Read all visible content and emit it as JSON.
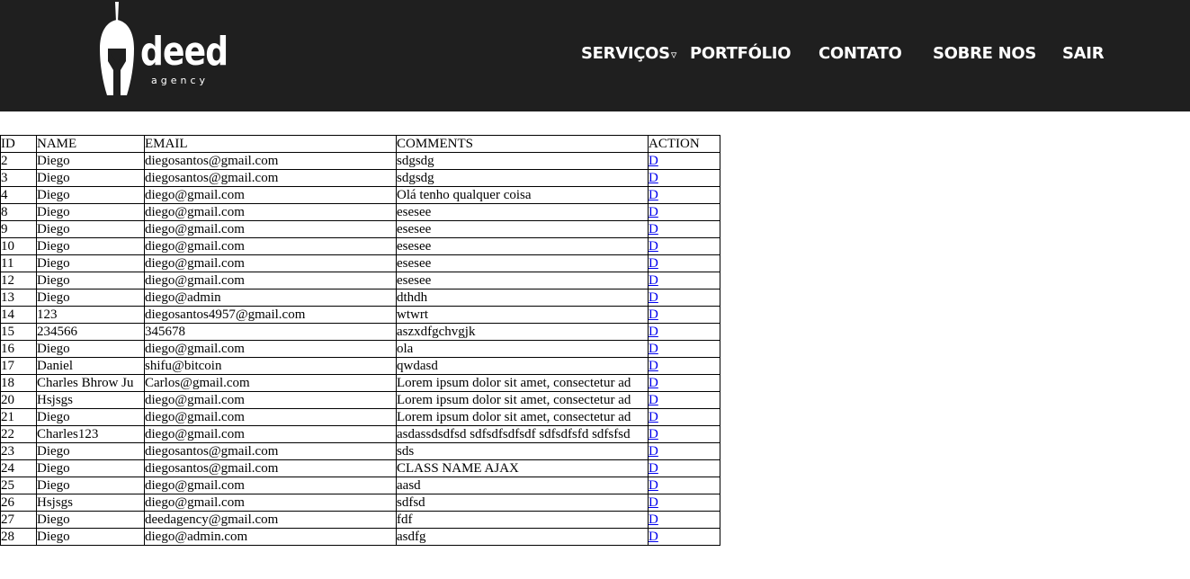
{
  "brand": {
    "name": "deed",
    "tagline": "agency"
  },
  "nav": {
    "items": [
      {
        "label": "SERVIÇOS",
        "caret": "▿"
      },
      {
        "label": "PORTFÓLIO"
      },
      {
        "label": "CONTATO"
      },
      {
        "label": "SOBRE NOS"
      },
      {
        "label": "SAIR"
      }
    ]
  },
  "table": {
    "headers": [
      "ID",
      "NAME",
      "EMAIL",
      "COMMENTS",
      "ACTION"
    ],
    "rows": [
      {
        "id": "2",
        "name": "Diego",
        "email": "diegosantos@gmail.com",
        "comments": "sdgsdg",
        "action": "D"
      },
      {
        "id": "3",
        "name": "Diego",
        "email": "diegosantos@gmail.com",
        "comments": "sdgsdg",
        "action": "D"
      },
      {
        "id": "4",
        "name": "Diego",
        "email": "diego@gmail.com",
        "comments": "Olá tenho qualquer coisa",
        "action": "D"
      },
      {
        "id": "8",
        "name": "Diego",
        "email": "diego@gmail.com",
        "comments": "esesee",
        "action": "D"
      },
      {
        "id": "9",
        "name": "Diego",
        "email": "diego@gmail.com",
        "comments": "esesee",
        "action": "D"
      },
      {
        "id": "10",
        "name": "Diego",
        "email": "diego@gmail.com",
        "comments": "esesee",
        "action": "D"
      },
      {
        "id": "11",
        "name": "Diego",
        "email": "diego@gmail.com",
        "comments": "esesee",
        "action": "D"
      },
      {
        "id": "12",
        "name": "Diego",
        "email": "diego@gmail.com",
        "comments": "esesee",
        "action": "D"
      },
      {
        "id": "13",
        "name": "Diego",
        "email": "diego@admin",
        "comments": "dthdh",
        "action": "D"
      },
      {
        "id": "14",
        "name": "123",
        "email": "diegosantos4957@gmail.com",
        "comments": "wtwrt",
        "action": "D"
      },
      {
        "id": "15",
        "name": "234566",
        "email": "345678",
        "comments": "aszxdfgchvgjk",
        "action": "D"
      },
      {
        "id": "16",
        "name": "Diego",
        "email": "diego@gmail.com",
        "comments": "ola",
        "action": "D"
      },
      {
        "id": "17",
        "name": "Daniel",
        "email": "shifu@bitcoin",
        "comments": "qwdasd",
        "action": "D"
      },
      {
        "id": "18",
        "name": "Charles Bhrow Ju",
        "email": "Carlos@gmail.com",
        "comments": "Lorem ipsum dolor sit amet, consectetur ad",
        "action": "D"
      },
      {
        "id": "20",
        "name": "Hsjsgs",
        "email": "diego@gmail.com",
        "comments": "Lorem ipsum dolor sit amet, consectetur ad",
        "action": "D"
      },
      {
        "id": "21",
        "name": "Diego",
        "email": "diego@gmail.com",
        "comments": "Lorem ipsum dolor sit amet, consectetur ad",
        "action": "D"
      },
      {
        "id": "22",
        "name": "Charles123",
        "email": "diego@gmail.com",
        "comments": "asdassdsdfsd sdfsdfsdfsdf sdfsdfsfd sdfsfsd",
        "action": "D"
      },
      {
        "id": "23",
        "name": "Diego",
        "email": "diegosantos@gmail.com",
        "comments": "sds",
        "action": "D"
      },
      {
        "id": "24",
        "name": "Diego",
        "email": "diegosantos@gmail.com",
        "comments": "CLASS NAME AJAX",
        "action": "D"
      },
      {
        "id": "25",
        "name": "Diego",
        "email": "diego@gmail.com",
        "comments": "aasd",
        "action": "D"
      },
      {
        "id": "26",
        "name": "Hsjsgs",
        "email": "diego@gmail.com",
        "comments": "sdfsd",
        "action": "D"
      },
      {
        "id": "27",
        "name": "Diego",
        "email": "deedagency@gmail.com",
        "comments": "fdf",
        "action": "D"
      },
      {
        "id": "28",
        "name": "Diego",
        "email": "diego@admin.com",
        "comments": "asdfg",
        "action": "D"
      }
    ]
  },
  "colors": {
    "header_bg": "#1f1f1f",
    "link": "#0000ee"
  },
  "icons": {
    "logo": "spartan-helmet-icon"
  }
}
